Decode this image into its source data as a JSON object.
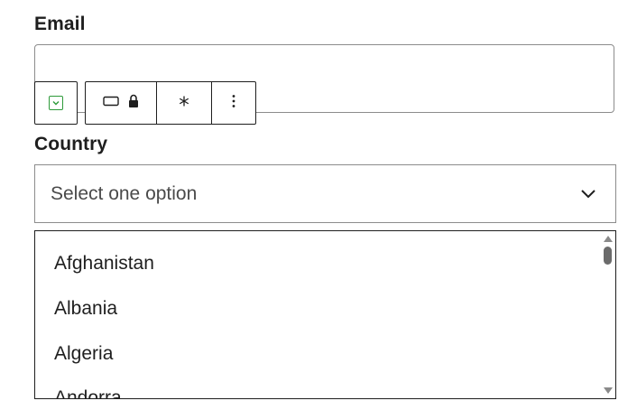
{
  "form": {
    "email_label": "Email",
    "email_value": "",
    "country_label": "Country",
    "country_placeholder": "Select one option"
  },
  "toolbar": {
    "block_switcher_icon": "select-block-icon",
    "buttons": [
      {
        "icon": "input-field-icon"
      },
      {
        "icon": "lock-icon"
      },
      {
        "icon": "asterisk-icon"
      },
      {
        "icon": "more-options-icon"
      }
    ]
  },
  "country_options": [
    "Afghanistan",
    "Albania",
    "Algeria",
    "Andorra"
  ],
  "colors": {
    "accent": "#2e9a3a",
    "text": "#1e1e1e",
    "border": "#8c8c8c"
  }
}
